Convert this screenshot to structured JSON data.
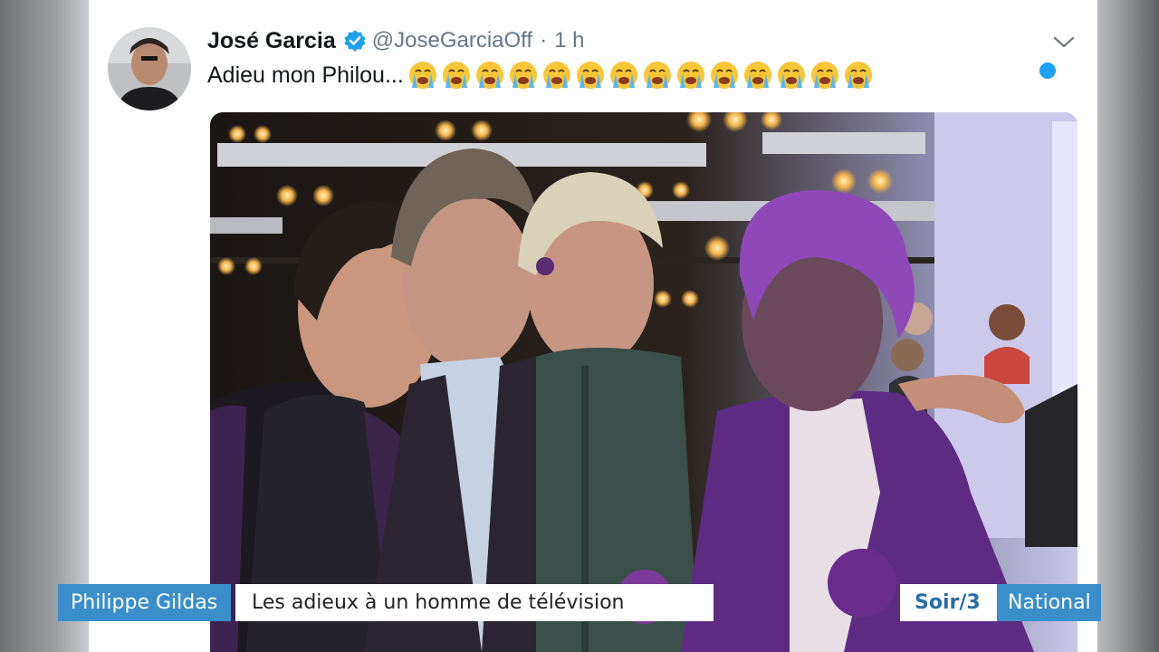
{
  "tweet": {
    "display_name": "José Garcia",
    "handle": "@JoseGarciaOff",
    "separator": "·",
    "time": "1 h",
    "text": "Adieu mon Philou...",
    "emoji_count": 14,
    "emoji_icon": "loudly-crying-face-icon"
  },
  "broadcast": {
    "topic": "Philippe Gildas",
    "headline": "Les adieux à un homme de télévision",
    "brand": "Soir/3",
    "channel": "National"
  },
  "colors": {
    "verified": "#1da1f2",
    "unread_dot": "#1da1f2",
    "banner_blue": "#3a8fca",
    "purple_paint": "#6a2c8a"
  }
}
